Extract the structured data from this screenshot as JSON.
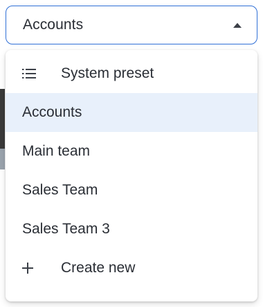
{
  "select": {
    "value": "Accounts",
    "icon": "chevron-up-icon"
  },
  "menu": {
    "items": [
      {
        "label": "System preset",
        "icon": "list-icon",
        "selected": false
      },
      {
        "label": "Accounts",
        "icon": "",
        "selected": true
      },
      {
        "label": "Main team",
        "icon": "",
        "selected": false
      },
      {
        "label": "Sales Team",
        "icon": "",
        "selected": false
      },
      {
        "label": "Sales Team 3",
        "icon": "",
        "selected": false
      },
      {
        "label": "Create new",
        "icon": "plus-icon",
        "selected": false
      }
    ]
  },
  "colors": {
    "focus_border": "#2f6fd6",
    "selected_bg": "#e8f0fb",
    "text": "#2a2e35"
  }
}
